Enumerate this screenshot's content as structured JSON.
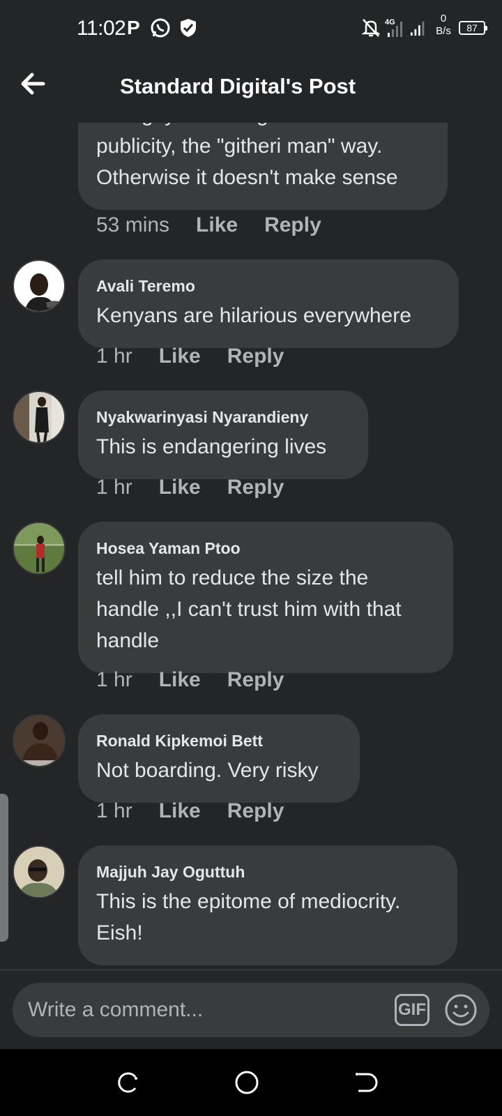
{
  "status_bar": {
    "time": "11:02",
    "p_label": "P",
    "net_speed_value": "0",
    "net_speed_unit": "B/s",
    "network_type": "4G",
    "battery": "87"
  },
  "header": {
    "title": "Standard Digital's Post"
  },
  "top_partial": {
    "text": "This guy is looking for fame and publicity, the \"githeri man\" way. Otherwise it doesn't make sense",
    "time": "53 mins",
    "like": "Like",
    "reply": "Reply"
  },
  "comments": [
    {
      "name": "Avali Teremo",
      "text": "Kenyans are hilarious everywhere",
      "time": "1 hr",
      "like": "Like",
      "reply": "Reply"
    },
    {
      "name": "Nyakwarinyasi Nyarandieny",
      "text": "This is endangering lives",
      "time": "1 hr",
      "like": "Like",
      "reply": "Reply"
    },
    {
      "name": "Hosea Yaman Ptoo",
      "text": "tell him to reduce the size the handle ,,I can't trust him with that handle",
      "time": "1 hr",
      "like": "Like",
      "reply": "Reply"
    },
    {
      "name": "Ronald Kipkemoi Bett",
      "text": "Not boarding. Very risky",
      "time": "1 hr",
      "like": "Like",
      "reply": "Reply"
    },
    {
      "name": "Majjuh Jay Oguttuh",
      "text": "This is the epitome of mediocrity. Eish!"
    }
  ],
  "composer": {
    "placeholder": "Write a comment...",
    "gif_label": "GIF"
  },
  "icons": {
    "back": "back-arrow-icon",
    "whatsapp": "whatsapp-icon",
    "shield": "shield-icon",
    "mute": "bell-off-icon",
    "smile": "smiley-icon"
  }
}
